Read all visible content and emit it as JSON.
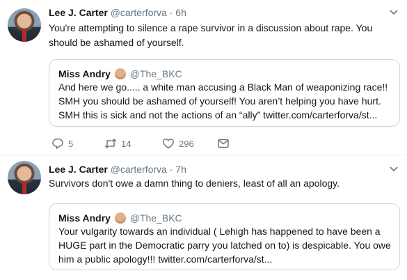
{
  "tweets": [
    {
      "author_name": "Lee J. Carter",
      "handle": "@carterforva",
      "separator": "·",
      "time": "6h",
      "text": "You're attempting to silence a rape survivor in a discussion about rape.  You should be ashamed of yourself.",
      "quote": {
        "name": "Miss Andry",
        "emoji": "fist-emoji",
        "handle": "@The_BKC",
        "text": "And here we go..... a white man accusing a Black Man of weaponizing race!! SMH you should be ashamed of yourself! You aren’t helping you have hurt. SMH this is sick and not the actions of an “ally” twitter.com/carterforva/st..."
      },
      "actions": {
        "replies": "5",
        "retweets": "14",
        "likes": "296"
      }
    },
    {
      "author_name": "Lee J. Carter",
      "handle": "@carterforva",
      "separator": "·",
      "time": "7h",
      "text": "Survivors don't owe a damn thing to deniers, least of all an apology.",
      "quote": {
        "name": "Miss Andry",
        "emoji": "fist-emoji",
        "handle": "@The_BKC",
        "text": "Your vulgarity towards an individual ( Lehigh has happened to have been a HUGE part in the Democratic parry you latched on to) is despicable. You owe him a public apology!!! twitter.com/carterforva/st..."
      }
    }
  ],
  "colors": {
    "muted": "#657786",
    "border": "#e6ecf0",
    "quote_border": "#ccd6dd",
    "text": "#14171a"
  }
}
